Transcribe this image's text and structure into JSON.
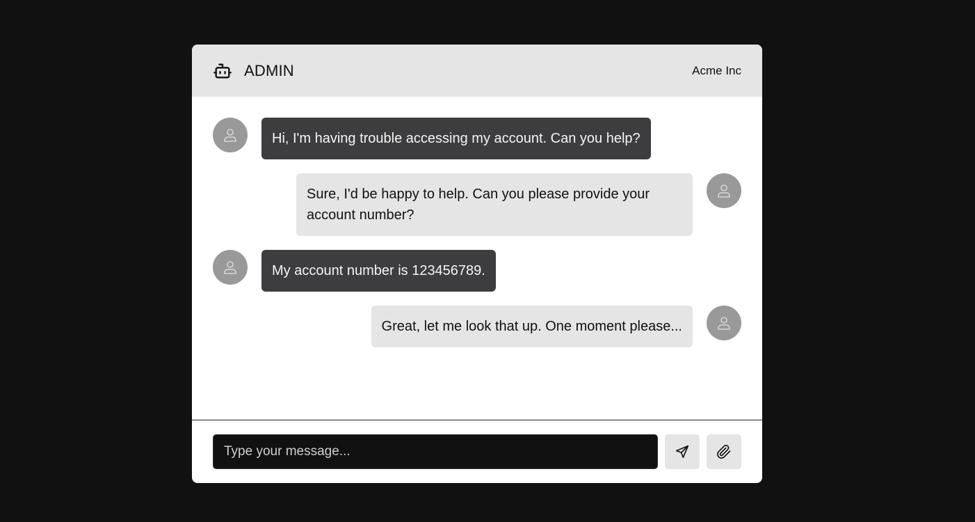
{
  "header": {
    "title": "ADMIN",
    "company": "Acme Inc",
    "logo_icon": "bot-icon"
  },
  "messages": [
    {
      "sender": "user",
      "style": "dark",
      "text": "Hi, I'm having trouble accessing my account. Can you help?"
    },
    {
      "sender": "agent",
      "style": "light",
      "text": "Sure, I'd be happy to help. Can you please provide your account number?"
    },
    {
      "sender": "user",
      "style": "dark",
      "text": "My account number is 123456789."
    },
    {
      "sender": "agent",
      "style": "light",
      "text": "Great, let me look that up. One moment please..."
    }
  ],
  "composer": {
    "placeholder": "Type your message...",
    "value": "",
    "send_icon": "send-icon",
    "attach_icon": "paperclip-icon"
  },
  "colors": {
    "page_background": "#111111",
    "header_background": "#e5e5e5",
    "dark_bubble": "#3d3d40",
    "light_bubble": "#e5e5e5",
    "avatar": "#999999"
  }
}
